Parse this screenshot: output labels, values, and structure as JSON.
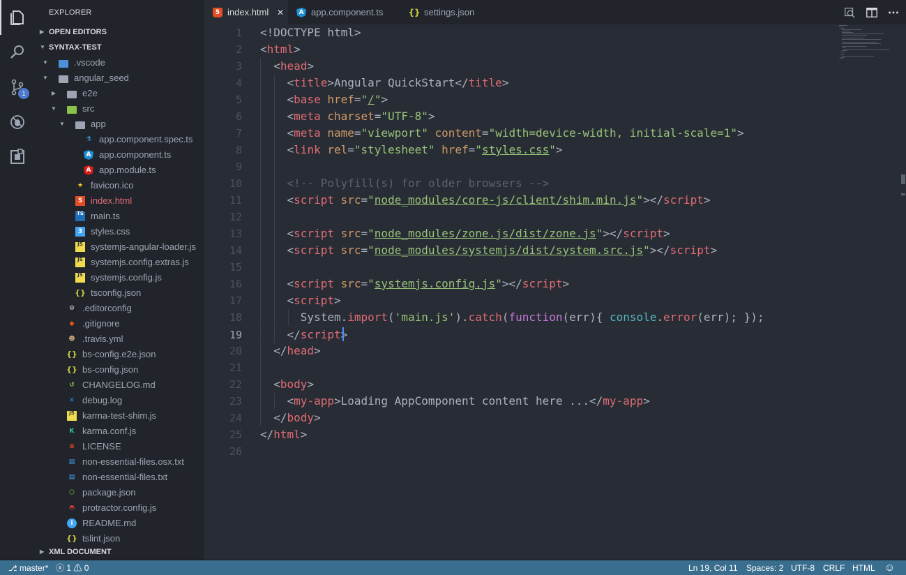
{
  "sidebar": {
    "title": "EXPLORER",
    "sections": {
      "open_editors": "OPEN EDITORS",
      "workspace": "SYNTAX-TEST",
      "xml": "XML DOCUMENT"
    },
    "tree": [
      {
        "label": ".vscode",
        "icon": "folder-vscode-icon"
      },
      {
        "label": "angular_seed",
        "icon": "folder-icon"
      },
      {
        "label": "e2e",
        "icon": "folder-icon"
      },
      {
        "label": "src",
        "icon": "folder-src-icon"
      },
      {
        "label": "app",
        "icon": "folder-app-icon"
      },
      {
        "label": "app.component.spec.ts",
        "icon": "flask-icon"
      },
      {
        "label": "app.component.ts",
        "icon": "angular-icon"
      },
      {
        "label": "app.module.ts",
        "icon": "angular-icon"
      },
      {
        "label": "favicon.ico",
        "icon": "star-icon"
      },
      {
        "label": "index.html",
        "icon": "html5-icon"
      },
      {
        "label": "main.ts",
        "icon": "typescript-icon"
      },
      {
        "label": "styles.css",
        "icon": "css3-icon"
      },
      {
        "label": "systemjs-angular-loader.js",
        "icon": "javascript-icon"
      },
      {
        "label": "systemjs.config.extras.js",
        "icon": "javascript-icon"
      },
      {
        "label": "systemjs.config.js",
        "icon": "javascript-icon"
      },
      {
        "label": "tsconfig.json",
        "icon": "json-icon"
      },
      {
        "label": ".editorconfig",
        "icon": "editorconfig-icon"
      },
      {
        "label": ".gitignore",
        "icon": "git-icon"
      },
      {
        "label": ".travis.yml",
        "icon": "travis-icon"
      },
      {
        "label": "bs-config.e2e.json",
        "icon": "json-icon"
      },
      {
        "label": "bs-config.json",
        "icon": "json-icon"
      },
      {
        "label": "CHANGELOG.md",
        "icon": "history-icon"
      },
      {
        "label": "debug.log",
        "icon": "vscode-icon"
      },
      {
        "label": "karma-test-shim.js",
        "icon": "javascript-icon"
      },
      {
        "label": "karma.conf.js",
        "icon": "karma-icon"
      },
      {
        "label": "LICENSE",
        "icon": "license-icon"
      },
      {
        "label": "non-essential-files.osx.txt",
        "icon": "text-file-icon"
      },
      {
        "label": "non-essential-files.txt",
        "icon": "text-file-icon"
      },
      {
        "label": "package.json",
        "icon": "nodejs-icon"
      },
      {
        "label": "protractor.config.js",
        "icon": "protractor-icon"
      },
      {
        "label": "README.md",
        "icon": "info-icon"
      },
      {
        "label": "tslint.json",
        "icon": "json-icon"
      }
    ]
  },
  "activity": {
    "scm_badge": "1"
  },
  "tabs": [
    {
      "label": "index.html",
      "icon": "html5-icon",
      "close": "✕"
    },
    {
      "label": "app.component.ts",
      "icon": "angular-icon"
    },
    {
      "label": "settings.json",
      "icon": "json-icon"
    }
  ],
  "editor": {
    "line_numbers": [
      "1",
      "2",
      "3",
      "4",
      "5",
      "6",
      "7",
      "8",
      "9",
      "10",
      "11",
      "12",
      "13",
      "14",
      "15",
      "16",
      "17",
      "18",
      "19",
      "20",
      "21",
      "22",
      "23",
      "24",
      "25",
      "26"
    ],
    "current_line": 19
  },
  "status": {
    "branch": "master*",
    "errors": "1",
    "warnings": "0",
    "position": "Ln 19, Col 11",
    "spaces": "Spaces: 2",
    "encoding": "UTF-8",
    "eol": "CRLF",
    "language": "HTML"
  },
  "colors": {
    "tag": "#e06c75",
    "attribute": "#d19a66",
    "string": "#98c379",
    "comment": "#5c6370",
    "keyword": "#c678dd",
    "function": "#61afef",
    "status_bar": "#3a6e8f"
  }
}
